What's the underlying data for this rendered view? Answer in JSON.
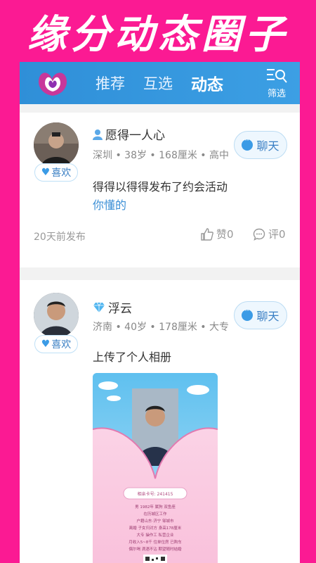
{
  "banner": {
    "title": "缘分动态圈子"
  },
  "app": {
    "tabs": [
      {
        "label": "推荐"
      },
      {
        "label": "互选"
      },
      {
        "label": "动态"
      }
    ],
    "filter_label": "筛选"
  },
  "posts": [
    {
      "name": "愿得一人心",
      "meta": "深圳 • 38岁 • 168厘米 • 高中",
      "like_label": "喜欢",
      "chat_label": "聊天",
      "content": "得得以得得发布了约会活动",
      "link": "你懂的",
      "time": "20天前发布",
      "likes_label": "赞0",
      "comments_label": "评0"
    },
    {
      "name": "浮云",
      "meta": "济南 • 40岁 • 178厘米 • 大专",
      "like_label": "喜欢",
      "chat_label": "聊天",
      "content": "上传了个人相册",
      "photo_text": {
        "id_line": "相亲卡号: 241415",
        "line1": "男    1982年    属狗    双鱼座",
        "line2": "在历城区工作",
        "line3": "户籍山东·济宁  邹城市",
        "line4": "离婚    子女归对方    身高178厘米",
        "line5": "大专    操作工    私营企业",
        "line6": "月收入5~8千    住单位房    已购车",
        "line7": "偶尔喝    滴酒不沾    期望随时结婚"
      }
    }
  ],
  "colors": {
    "background": "#fb1a93",
    "appbar": "#3c9fe4",
    "accent": "#3b9be6"
  }
}
